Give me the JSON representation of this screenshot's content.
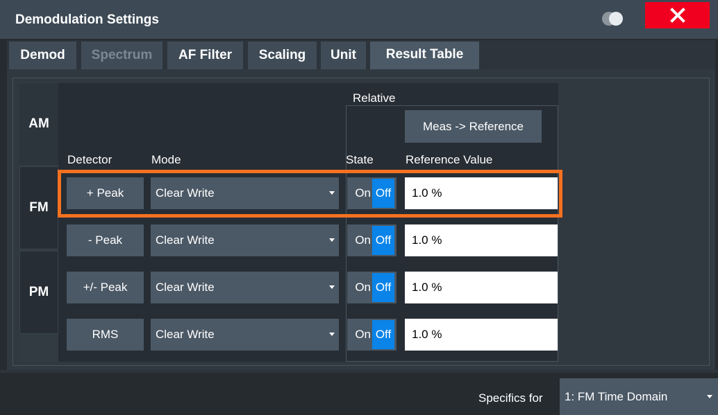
{
  "window": {
    "title": "Demodulation Settings",
    "close_icon": "close-x-icon",
    "toggle_icon": "toggle-icon"
  },
  "tabs": [
    {
      "label": "Demod",
      "state": "normal"
    },
    {
      "label": "Spectrum",
      "state": "disabled"
    },
    {
      "label": "AF Filter",
      "state": "normal"
    },
    {
      "label": "Scaling",
      "state": "normal"
    },
    {
      "label": "Unit",
      "state": "normal"
    },
    {
      "label": "Result Table",
      "state": "active"
    }
  ],
  "modulation_tabs": [
    {
      "label": "AM",
      "active": true
    },
    {
      "label": "FM",
      "active": false
    },
    {
      "label": "PM",
      "active": false
    }
  ],
  "relative": {
    "label": "Relative",
    "meas_button": "Meas -> Reference"
  },
  "headers": {
    "detector": "Detector",
    "mode": "Mode",
    "state": "State",
    "reference_value": "Reference Value"
  },
  "rows": [
    {
      "detector": "+ Peak",
      "mode": "Clear Write",
      "state_on": "On",
      "state_off": "Off",
      "reference": "1.0 %",
      "highlighted": true
    },
    {
      "detector": "- Peak",
      "mode": "Clear Write",
      "state_on": "On",
      "state_off": "Off",
      "reference": "1.0 %",
      "highlighted": false
    },
    {
      "detector": "+/- Peak",
      "mode": "Clear Write",
      "state_on": "On",
      "state_off": "Off",
      "reference": "1.0 %",
      "highlighted": false
    },
    {
      "detector": "RMS",
      "mode": "Clear Write",
      "state_on": "On",
      "state_off": "Off",
      "reference": "1.0 %",
      "highlighted": false
    }
  ],
  "footer": {
    "specifics_label": "Specifics for",
    "specifics_value": "1: FM Time Domain"
  },
  "colors": {
    "close": "#f0001e",
    "highlight": "#f5711f",
    "state_off": "#0a84e8"
  }
}
